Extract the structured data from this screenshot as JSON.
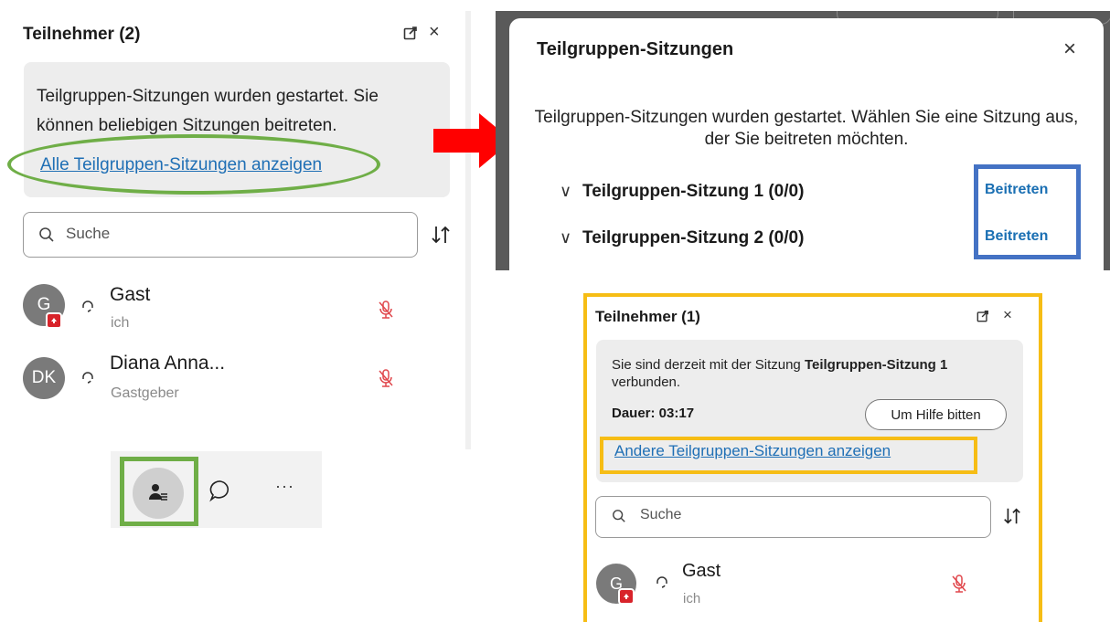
{
  "left_panel": {
    "title": "Teilnehmer (2)",
    "close": "×",
    "banner_text": "Teilgruppen-Sitzungen wurden gestartet. Sie können beliebigen Sitzungen beitreten.",
    "banner_link": "Alle Teilgruppen-Sitzungen anzeigen",
    "search_placeholder": "Suche",
    "participants": [
      {
        "initials": "G",
        "name": "Gast",
        "sub": "ich"
      },
      {
        "initials": "DK",
        "name": "Diana Anna...",
        "sub": "Gastgeber"
      }
    ],
    "more": "···"
  },
  "dialog": {
    "title": "Teilgruppen-Sitzungen",
    "close": "×",
    "message": "Teilgruppen-Sitzungen wurden gestartet. Wählen Sie eine Sitzung aus, der Sie beitreten möchten.",
    "sessions": [
      {
        "name": "Teilgruppen-Sitzung 1 (0/0)",
        "join": "Beitreten"
      },
      {
        "name": "Teilgruppen-Sitzung 2 (0/0)",
        "join": "Beitreten"
      }
    ],
    "chevron": "∨"
  },
  "right_panel": {
    "title": "Teilnehmer (1)",
    "close": "×",
    "status_prefix": "Sie sind derzeit mit der Sitzung ",
    "status_session": "Teilgruppen-Sitzung 1",
    "status_suffix": " verbunden.",
    "duration": "Dauer: 03:17",
    "help_button": "Um Hilfe bitten",
    "link": "Andere Teilgruppen-Sitzungen anzeigen",
    "search_placeholder": "Suche",
    "participant": {
      "initials": "G",
      "name": "Gast",
      "sub": "ich"
    }
  },
  "colors": {
    "highlight_green": "#6fae47",
    "highlight_blue": "#4472c4",
    "highlight_yellow": "#f6bd15",
    "arrow_red": "#ff0000",
    "link_blue": "#1f6fb5"
  }
}
